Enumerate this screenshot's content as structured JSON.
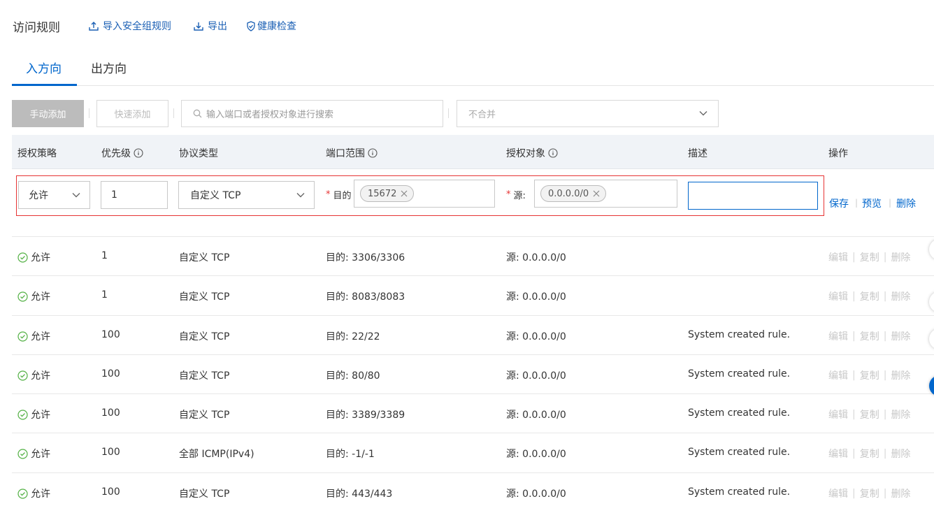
{
  "header": {
    "title": "访问规则",
    "import_label": "导入安全组规则",
    "export_label": "导出",
    "health_label": "健康检查"
  },
  "tabs": [
    {
      "label": "入方向",
      "active": true
    },
    {
      "label": "出方向",
      "active": false
    }
  ],
  "toolbar": {
    "manual_add": "手动添加",
    "quick_add": "快速添加",
    "search_placeholder": "输入端口或者授权对象进行搜索",
    "merge_value": "不合并"
  },
  "columns": {
    "policy": "授权策略",
    "priority": "优先级",
    "protocol": "协议类型",
    "port": "端口范围",
    "target": "授权对象",
    "desc": "描述",
    "ops": "操作"
  },
  "edit_row": {
    "policy": "允许",
    "priority": "1",
    "protocol": "自定义 TCP",
    "port_label": "目的",
    "port_tag": "15672",
    "src_label": "源:",
    "src_tag": "0.0.0.0/0",
    "desc": "",
    "save": "保存",
    "preview": "预览",
    "delete": "删除"
  },
  "row_actions": {
    "edit": "编辑",
    "copy": "复制",
    "delete": "删除"
  },
  "rows": [
    {
      "policy": "允许",
      "priority": "1",
      "protocol": "自定义 TCP",
      "port": "目的: 3306/3306",
      "target": "源: 0.0.0.0/0",
      "desc": ""
    },
    {
      "policy": "允许",
      "priority": "1",
      "protocol": "自定义 TCP",
      "port": "目的: 8083/8083",
      "target": "源: 0.0.0.0/0",
      "desc": ""
    },
    {
      "policy": "允许",
      "priority": "100",
      "protocol": "自定义 TCP",
      "port": "目的: 22/22",
      "target": "源: 0.0.0.0/0",
      "desc": "System created rule."
    },
    {
      "policy": "允许",
      "priority": "100",
      "protocol": "自定义 TCP",
      "port": "目的: 80/80",
      "target": "源: 0.0.0.0/0",
      "desc": "System created rule."
    },
    {
      "policy": "允许",
      "priority": "100",
      "protocol": "自定义 TCP",
      "port": "目的: 3389/3389",
      "target": "源: 0.0.0.0/0",
      "desc": "System created rule."
    },
    {
      "policy": "允许",
      "priority": "100",
      "protocol": "全部 ICMP(IPv4)",
      "port": "目的: -1/-1",
      "target": "源: 0.0.0.0/0",
      "desc": "System created rule."
    },
    {
      "policy": "允许",
      "priority": "100",
      "protocol": "自定义 TCP",
      "port": "目的: 443/443",
      "target": "源: 0.0.0.0/0",
      "desc": "System created rule."
    }
  ],
  "colors": {
    "accent": "#0066cc",
    "error": "#e63434",
    "success": "#52b043",
    "disabled": "#c8c8c8"
  }
}
